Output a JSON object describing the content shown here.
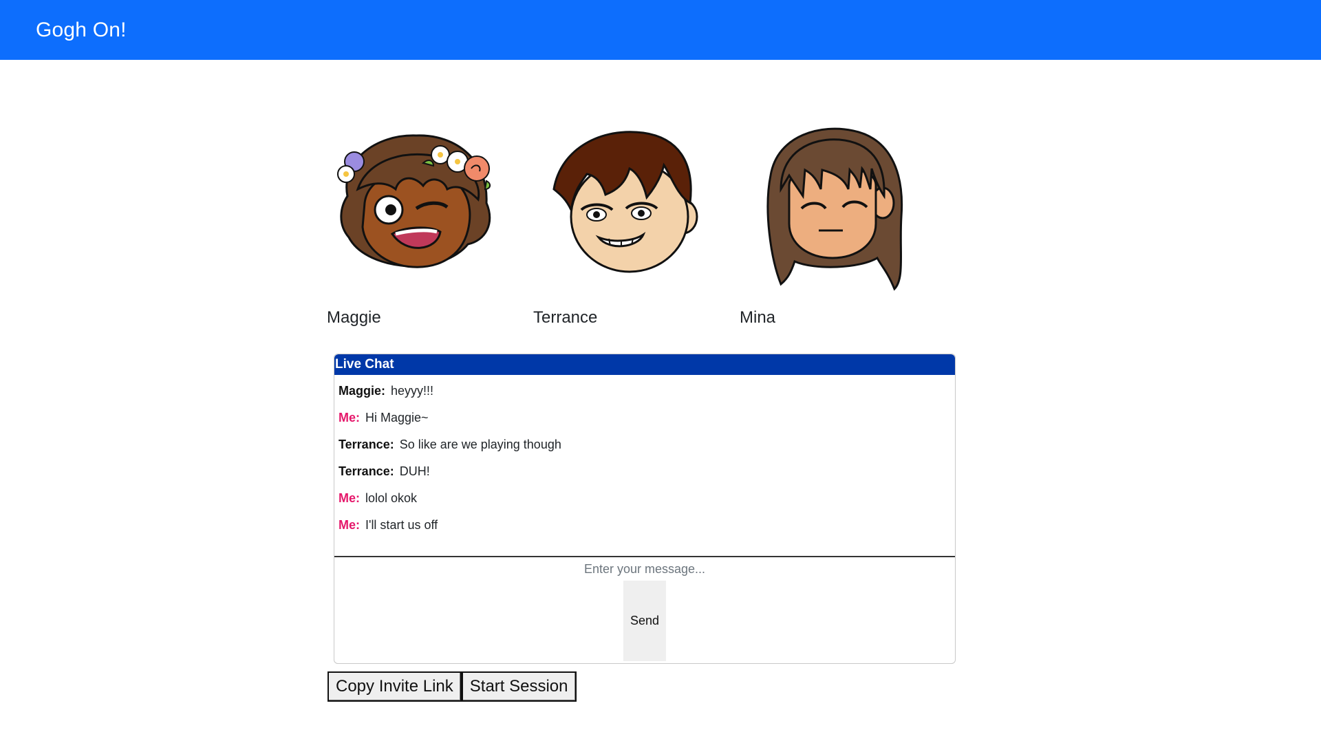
{
  "navbar": {
    "brand": "Gogh On!",
    "color": "#0d6efd"
  },
  "players": [
    {
      "name": "Maggie",
      "avatar_icon": "maggie-avatar"
    },
    {
      "name": "Terrance",
      "avatar_icon": "terrance-avatar"
    },
    {
      "name": "Mina",
      "avatar_icon": "mina-avatar"
    }
  ],
  "chat": {
    "title": "Live Chat",
    "header_color": "#0038a8",
    "me_color": "#e5176a",
    "messages": [
      {
        "author": "Maggie:",
        "text": "heyyy!!!",
        "is_me": false
      },
      {
        "author": "Me:",
        "text": "Hi Maggie~",
        "is_me": true
      },
      {
        "author": "Terrance:",
        "text": "So like are we playing though",
        "is_me": false
      },
      {
        "author": "Terrance:",
        "text": "DUH!",
        "is_me": false
      },
      {
        "author": "Me:",
        "text": "lolol okok",
        "is_me": true
      },
      {
        "author": "Me:",
        "text": "I'll start us off",
        "is_me": true
      }
    ],
    "input_placeholder": "Enter your message...",
    "input_value": "",
    "send_label": "Send"
  },
  "actions": {
    "copy_invite_label": "Copy Invite Link",
    "start_session_label": "Start Session"
  }
}
